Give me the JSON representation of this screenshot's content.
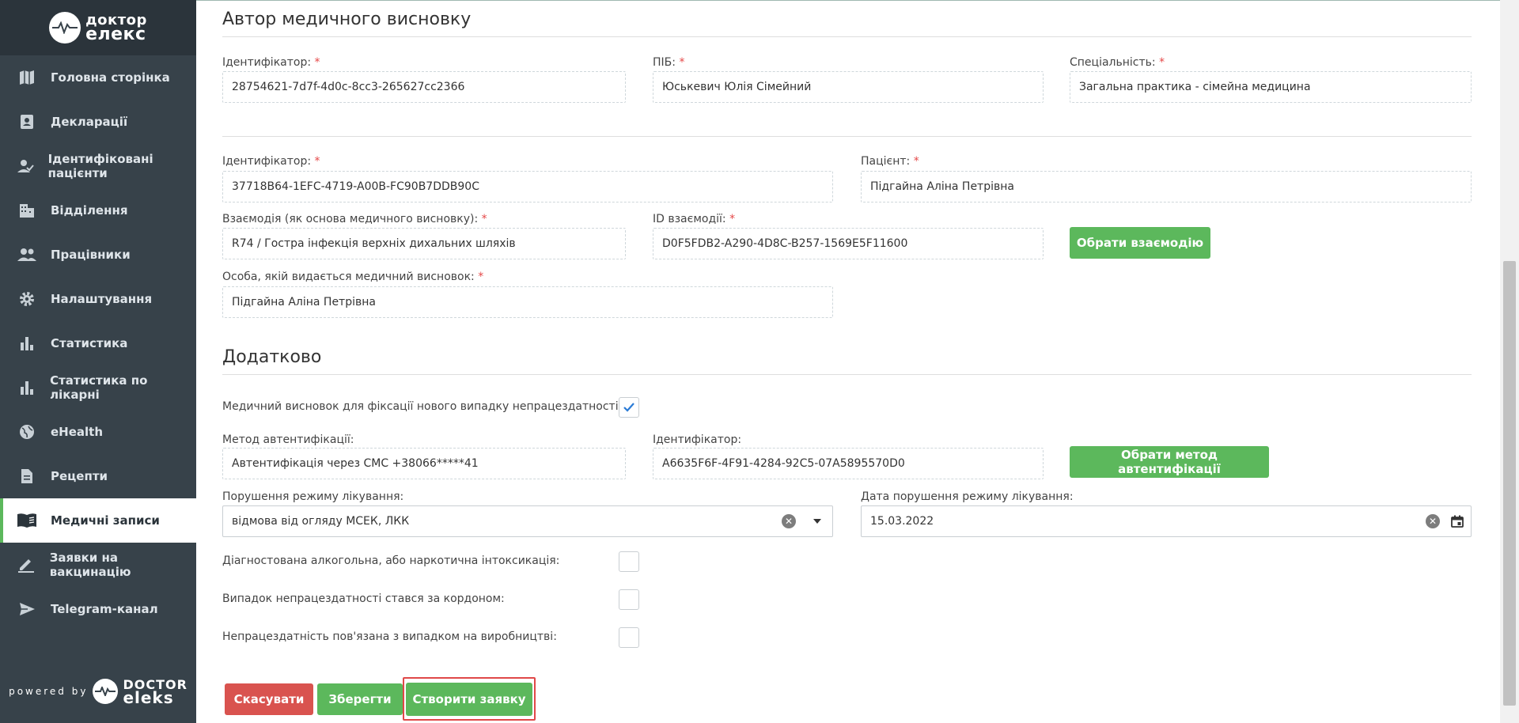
{
  "logo": {
    "line1": "доктор",
    "line2": "елекс"
  },
  "sidebar": {
    "items": [
      {
        "label": "Головна сторінка",
        "icon": "map-icon"
      },
      {
        "label": "Декларації",
        "icon": "contact-card-icon"
      },
      {
        "label": "Ідентифіковані пацієнти",
        "icon": "user-check-icon"
      },
      {
        "label": "Відділення",
        "icon": "building-icon"
      },
      {
        "label": "Працівники",
        "icon": "users-icon"
      },
      {
        "label": "Налаштування",
        "icon": "gear-icon"
      },
      {
        "label": "Статистика",
        "icon": "bar-chart-icon"
      },
      {
        "label": "Статистика по лікарні",
        "icon": "bar-chart-icon"
      },
      {
        "label": "eHealth",
        "icon": "globe-icon"
      },
      {
        "label": "Рецепти",
        "icon": "document-icon"
      },
      {
        "label": "Медичні записи",
        "icon": "book-icon",
        "active": true
      },
      {
        "label": "Заявки на вакцинацію",
        "icon": "pencil-icon"
      },
      {
        "label": "Telegram-канал",
        "icon": "send-icon"
      }
    ],
    "powered_by": "powered by",
    "brand_line1": "DOCTOR",
    "brand_line2": "eleks"
  },
  "author": {
    "heading": "Автор медичного висновку",
    "id_label": "Ідентифікатор:",
    "id_value": "28754621-7d7f-4d0c-8cc3-265627cc2366",
    "name_label": "ПІБ:",
    "name_value": "Юськевич Юлія Сімейний",
    "spec_label": "Спеціальність:",
    "spec_value": "Загальна практика - сімейна медицина"
  },
  "patient": {
    "id_label": "Ідентифікатор:",
    "id_value": "37718B64-1EFC-4719-A00B-FC90B7DDB90C",
    "patient_label": "Пацієнт:",
    "patient_value": "Підгайна Аліна Петрівна",
    "interaction_label": "Взаємодія (як основа медичного висновку):",
    "interaction_value": "R74 / Гостра інфекція верхніх дихальних шляхів",
    "interaction_id_label": "ID взаємодії:",
    "interaction_id_value": "D0F5FDB2-A290-4D8C-B257-1569E5F11600",
    "choose_interaction": "Обрати взаємодію",
    "person_label": "Особа, якій видається медичний висновок:",
    "person_value": "Підгайна Аліна Петрівна"
  },
  "additional": {
    "heading": "Додатково",
    "new_case_label": "Медичний висновок для фіксації нового випадку непрацездатності:",
    "new_case_checked": true,
    "auth_method_label": "Метод автентифікації:",
    "auth_method_value": "Автентифікація через СМС +38066*****41",
    "auth_id_label": "Ідентифікатор:",
    "auth_id_value": "A6635F6F-4F91-4284-92C5-07A5895570D0",
    "choose_auth": "Обрати метод автентифікації",
    "violation_label": "Порушення режиму лікування:",
    "violation_value": "відмова від огляду МСЕК, ЛКК",
    "violation_date_label": "Дата порушення режиму лікування:",
    "violation_date_value": "15.03.2022",
    "intoxication_label": "Діагностована алкогольна, або наркотична інтоксикація:",
    "abroad_label": "Випадок непрацездатності стався за кордоном:",
    "work_related_label": "Непрацездатність пов'язана з випадком на виробництві:"
  },
  "actions": {
    "cancel": "Скасувати",
    "save": "Зберегти",
    "create_request": "Створити заявку"
  },
  "colors": {
    "green": "#5cb85c",
    "red": "#d9534f",
    "sidebar": "#37424a"
  }
}
